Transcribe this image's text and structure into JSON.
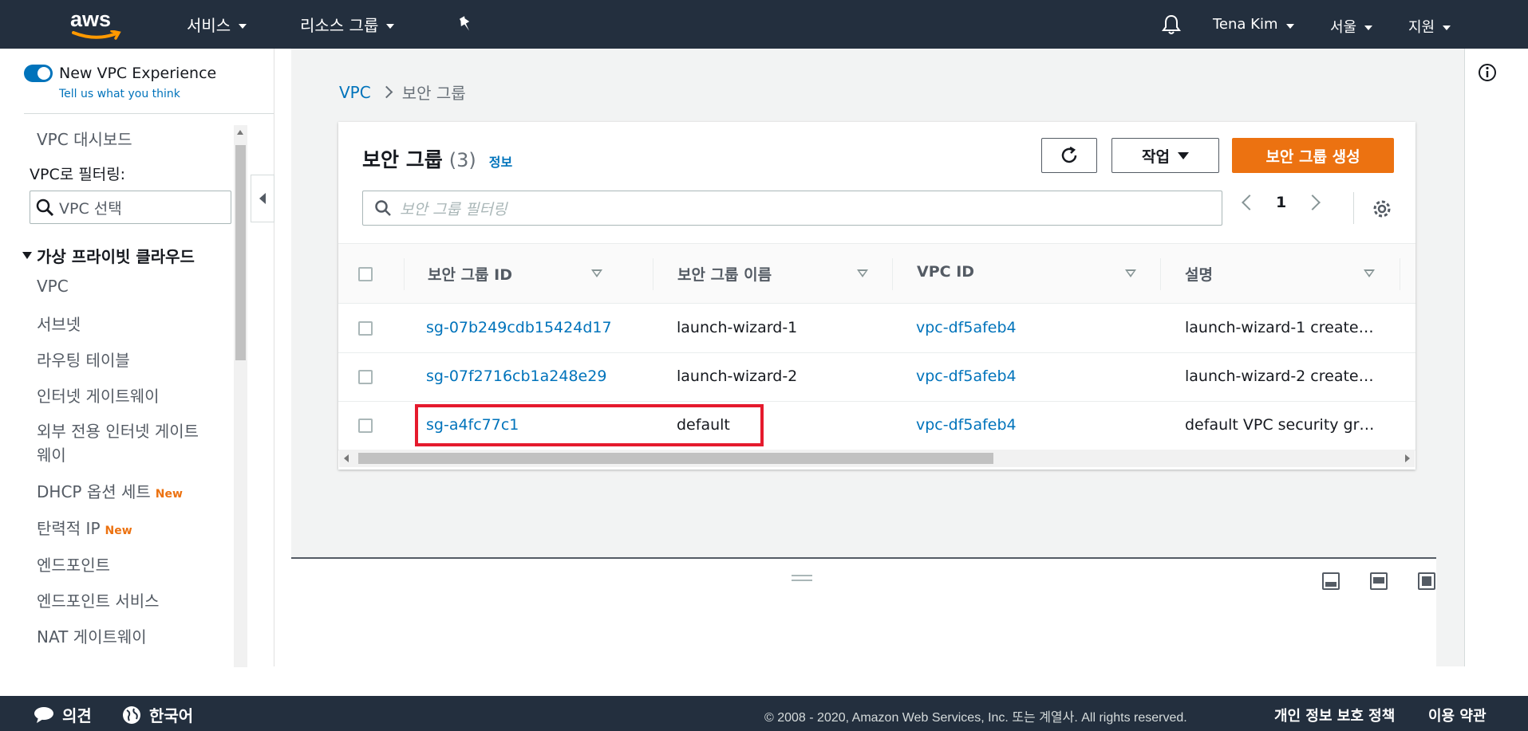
{
  "nav": {
    "logo": "aws",
    "services": "서비스",
    "resource_groups": "리소스 그룹",
    "user": "Tena Kim",
    "region": "서울",
    "support": "지원"
  },
  "sidebar": {
    "toggle_label": "New VPC Experience",
    "feedback_link": "Tell us what you think",
    "dashboard": "VPC 대시보드",
    "filter_label": "VPC로 필터링:",
    "vpc_select_placeholder": "VPC 선택",
    "section_title": "가상 프라이빗 클라우드",
    "items": [
      {
        "label": "VPC",
        "badge": ""
      },
      {
        "label": "서브넷",
        "badge": ""
      },
      {
        "label": "라우팅 테이블",
        "badge": ""
      },
      {
        "label": "인터넷 게이트웨이",
        "badge": ""
      },
      {
        "label": "외부 전용 인터넷 게이트",
        "badge": ""
      },
      {
        "label": "웨이",
        "badge": ""
      },
      {
        "label": "DHCP 옵션 세트",
        "badge": "New"
      },
      {
        "label": "탄력적 IP",
        "badge": "New"
      },
      {
        "label": "엔드포인트",
        "badge": ""
      },
      {
        "label": "엔드포인트 서비스",
        "badge": ""
      },
      {
        "label": "NAT 게이트웨이",
        "badge": ""
      }
    ]
  },
  "breadcrumb": {
    "root": "VPC",
    "current": "보안 그룹"
  },
  "panel": {
    "title": "보안 그룹",
    "count": "(3)",
    "info_link": "정보",
    "actions_button": "작업",
    "create_button": "보안 그룹 생성",
    "search_placeholder": "보안 그룹 필터링",
    "page_number": "1"
  },
  "table": {
    "columns": [
      "보안 그룹 ID",
      "보안 그룹 이름",
      "VPC ID",
      "설명"
    ],
    "rows": [
      {
        "id": "sg-07b249cdb15424d17",
        "name": "launch-wizard-1",
        "vpc": "vpc-df5afeb4",
        "desc": "launch-wizard-1 create…"
      },
      {
        "id": "sg-07f2716cb1a248e29",
        "name": "launch-wizard-2",
        "vpc": "vpc-df5afeb4",
        "desc": "launch-wizard-2 create…"
      },
      {
        "id": "sg-a4fc77c1",
        "name": "default",
        "vpc": "vpc-df5afeb4",
        "desc": "default VPC security gr…"
      }
    ]
  },
  "footer": {
    "feedback": "의견",
    "language": "한국어",
    "copyright": "© 2008 - 2020, Amazon Web Services, Inc. 또는 계열사. All rights reserved.",
    "privacy": "개인 정보 보호 정책",
    "terms": "이용 약관"
  },
  "colors": {
    "nav_bg": "#232f3e",
    "link": "#0073bb",
    "primary": "#ec7211",
    "highlight": "#e51a2d"
  }
}
